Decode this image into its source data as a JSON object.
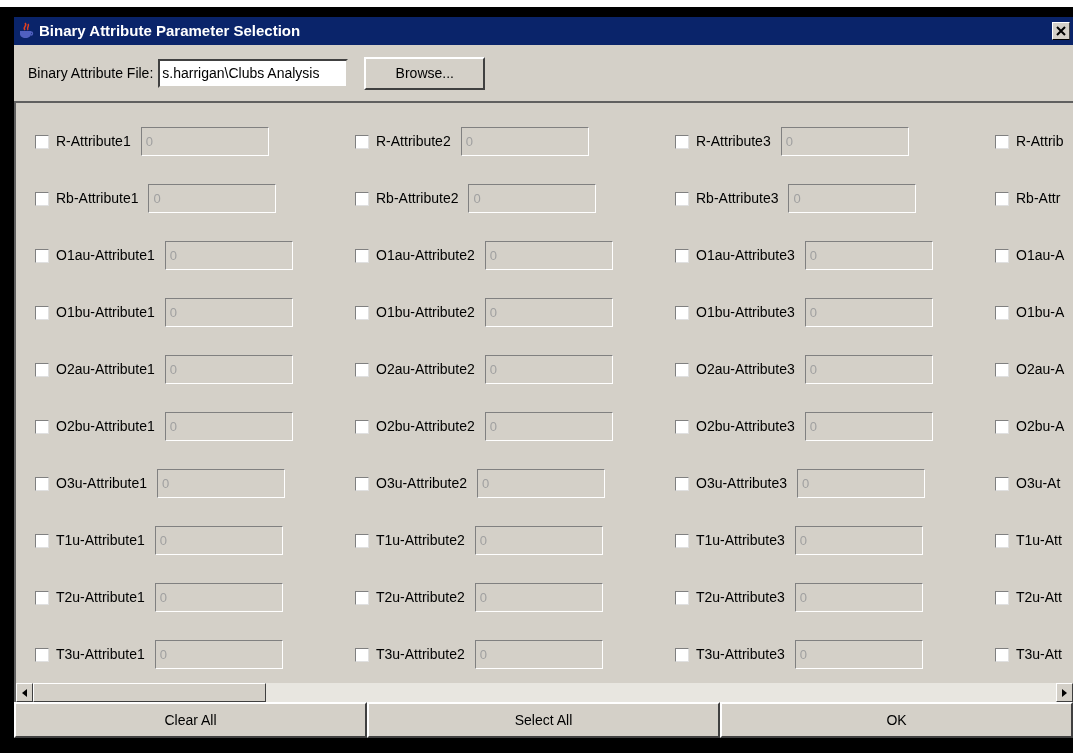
{
  "window": {
    "title": "Binary Attribute Parameter Selection"
  },
  "file_row": {
    "label": "Binary Attribute File:",
    "value": "s.harrigan\\Clubs Analysis",
    "browse": "Browse..."
  },
  "rows": [
    {
      "cells": [
        {
          "label": "R-Attribute1",
          "checked": false,
          "value": "0",
          "disabled": true
        },
        {
          "label": "R-Attribute2",
          "checked": false,
          "value": "0",
          "disabled": true
        },
        {
          "label": "R-Attribute3",
          "checked": false,
          "value": "0",
          "disabled": true
        },
        {
          "label": "R-Attrib",
          "checked": false
        }
      ]
    },
    {
      "cells": [
        {
          "label": "Rb-Attribute1",
          "checked": false,
          "value": "0",
          "disabled": true
        },
        {
          "label": "Rb-Attribute2",
          "checked": false,
          "value": "0",
          "disabled": true
        },
        {
          "label": "Rb-Attribute3",
          "checked": false,
          "value": "0",
          "disabled": true
        },
        {
          "label": "Rb-Attr",
          "checked": false
        }
      ]
    },
    {
      "cells": [
        {
          "label": "O1au-Attribute1",
          "checked": false,
          "value": "0",
          "disabled": true
        },
        {
          "label": "O1au-Attribute2",
          "checked": false,
          "value": "0",
          "disabled": true
        },
        {
          "label": "O1au-Attribute3",
          "checked": false,
          "value": "0",
          "disabled": true
        },
        {
          "label": "O1au-A",
          "checked": false
        }
      ]
    },
    {
      "cells": [
        {
          "label": "O1bu-Attribute1",
          "checked": false,
          "value": "0",
          "disabled": true
        },
        {
          "label": "O1bu-Attribute2",
          "checked": false,
          "value": "0",
          "disabled": true
        },
        {
          "label": "O1bu-Attribute3",
          "checked": false,
          "value": "0",
          "disabled": true
        },
        {
          "label": "O1bu-A",
          "checked": false
        }
      ]
    },
    {
      "cells": [
        {
          "label": "O2au-Attribute1",
          "checked": false,
          "value": "0",
          "disabled": true
        },
        {
          "label": "O2au-Attribute2",
          "checked": false,
          "value": "0",
          "disabled": true
        },
        {
          "label": "O2au-Attribute3",
          "checked": false,
          "value": "0",
          "disabled": true
        },
        {
          "label": "O2au-A",
          "checked": false
        }
      ]
    },
    {
      "cells": [
        {
          "label": "O2bu-Attribute1",
          "checked": false,
          "value": "0",
          "disabled": true
        },
        {
          "label": "O2bu-Attribute2",
          "checked": false,
          "value": "0",
          "disabled": true
        },
        {
          "label": "O2bu-Attribute3",
          "checked": false,
          "value": "0",
          "disabled": true
        },
        {
          "label": "O2bu-A",
          "checked": false
        }
      ]
    },
    {
      "cells": [
        {
          "label": "O3u-Attribute1",
          "checked": false,
          "value": "0",
          "disabled": true
        },
        {
          "label": "O3u-Attribute2",
          "checked": false,
          "value": "0",
          "disabled": true
        },
        {
          "label": "O3u-Attribute3",
          "checked": false,
          "value": "0",
          "disabled": true
        },
        {
          "label": "O3u-At",
          "checked": false
        }
      ]
    },
    {
      "cells": [
        {
          "label": "T1u-Attribute1",
          "checked": false,
          "value": "0",
          "disabled": true
        },
        {
          "label": "T1u-Attribute2",
          "checked": false,
          "value": "0",
          "disabled": true
        },
        {
          "label": "T1u-Attribute3",
          "checked": false,
          "value": "0",
          "disabled": true
        },
        {
          "label": "T1u-Att",
          "checked": false
        }
      ]
    },
    {
      "cells": [
        {
          "label": "T2u-Attribute1",
          "checked": false,
          "value": "0",
          "disabled": true
        },
        {
          "label": "T2u-Attribute2",
          "checked": false,
          "value": "0",
          "disabled": true
        },
        {
          "label": "T2u-Attribute3",
          "checked": false,
          "value": "0",
          "disabled": true
        },
        {
          "label": "T2u-Att",
          "checked": false
        }
      ]
    },
    {
      "cells": [
        {
          "label": "T3u-Attribute1",
          "checked": false,
          "value": "0",
          "disabled": true
        },
        {
          "label": "T3u-Attribute2",
          "checked": false,
          "value": "0",
          "disabled": true
        },
        {
          "label": "T3u-Attribute3",
          "checked": false,
          "value": "0",
          "disabled": true
        },
        {
          "label": "T3u-Att",
          "checked": false
        }
      ]
    }
  ],
  "buttons": [
    "Clear All",
    "Select All",
    "OK"
  ]
}
